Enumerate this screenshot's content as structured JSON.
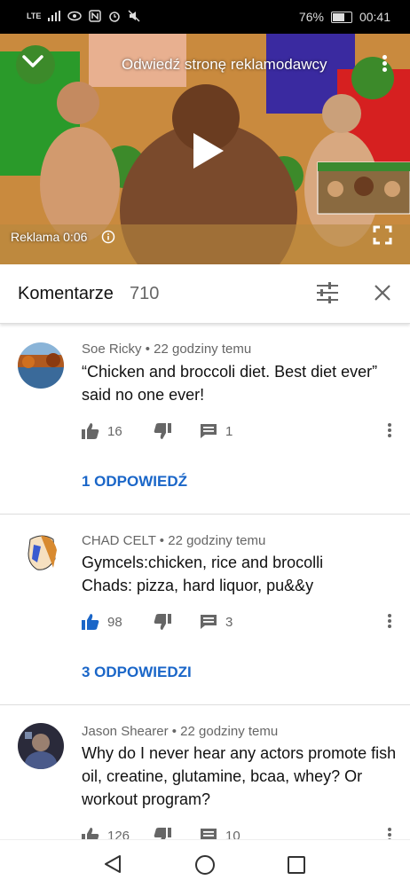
{
  "status_bar": {
    "network": "LTE",
    "battery": "76%",
    "time": "00:41"
  },
  "video": {
    "advertiser_link": "Odwiedź stronę reklamodawcy",
    "ad_label": "Reklama",
    "ad_time": "0:06"
  },
  "comments_header": {
    "title": "Komentarze",
    "count": "710"
  },
  "comments": [
    {
      "author": "Soe Ricky",
      "time": "22 godziny temu",
      "text_line1": "“Chicken and broccoli diet. Best diet ever”",
      "text_line2": "said no one ever!",
      "likes": "16",
      "replies_count": "1",
      "replies_label": "1 ODPOWIEDŹ",
      "liked": false
    },
    {
      "author": "CHAD CELT",
      "time": "22 godziny temu",
      "text_line1": "Gymcels:chicken, rice and brocolli",
      "text_line2": "Chads: pizza, hard liquor, pu&&y",
      "likes": "98",
      "replies_count": "3",
      "replies_label": "3 ODPOWIEDZI",
      "liked": true
    },
    {
      "author": "Jason Shearer",
      "time": "22 godziny temu",
      "text_line1": "Why do I never hear any actors promote fish",
      "text_line2": "oil, creatine, glutamine, bcaa, whey? Or",
      "text_line3": "workout program?",
      "likes": "126",
      "replies_count": "10",
      "liked": false
    }
  ],
  "colors": {
    "accent": "#1a66c8",
    "text": "#111111",
    "meta": "#666666"
  }
}
